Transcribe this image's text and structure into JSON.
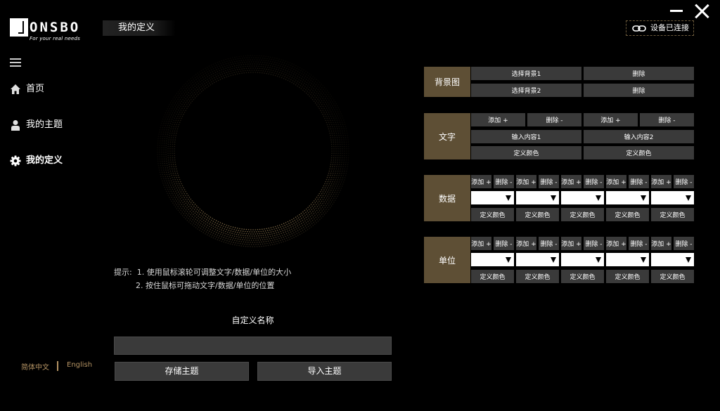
{
  "brand": {
    "name": "ONSBO",
    "tagline": "For your real needs"
  },
  "header": {
    "title": "我的定义",
    "device_status": "设备已连接"
  },
  "sidebar": {
    "items": [
      {
        "label": "首页",
        "icon": "home-icon"
      },
      {
        "label": "我的主题",
        "icon": "user-icon"
      },
      {
        "label": "我的定义",
        "icon": "gear-icon",
        "active": true
      }
    ],
    "languages": [
      "简体中文",
      "English"
    ]
  },
  "hints": {
    "prefix": "提示:",
    "line1": "1. 使用鼠标滚轮可调整文字/数据/单位的大小",
    "line2": "2. 按住鼠标可拖动文字/数据/单位的位置"
  },
  "custom_name": {
    "label": "自定义名称",
    "value": "",
    "placeholder": ""
  },
  "actions": {
    "save": "存储主题",
    "import": "导入主题"
  },
  "panel": {
    "background": {
      "label": "背景图",
      "select1": "选择背景1",
      "delete1": "删除",
      "select2": "选择背景2",
      "delete2": "删除"
    },
    "text": {
      "label": "文字",
      "add": "添加 +",
      "remove": "删除 -",
      "input1": "输入内容1",
      "input2": "输入内容2",
      "color": "定义颜色"
    },
    "data": {
      "label": "数据",
      "add": "添加 +",
      "remove": "删除 -",
      "color": "定义颜色"
    },
    "unit": {
      "label": "单位",
      "add": "添加 +",
      "remove": "删除 -",
      "color": "定义颜色"
    }
  },
  "colors": {
    "accent": "#5e4f35",
    "gold_text": "#b49363",
    "button": "#3a3a3a"
  }
}
